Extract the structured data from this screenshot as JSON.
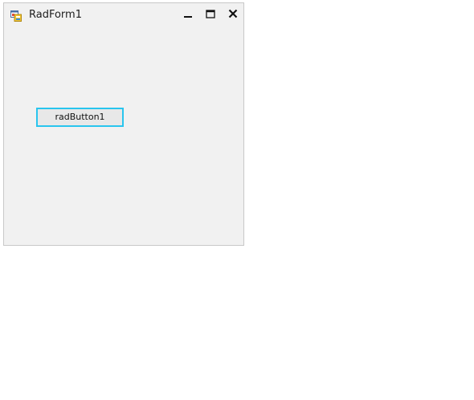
{
  "window": {
    "title": "RadForm1",
    "icon": "app-form-icon",
    "controls": {
      "minimize": "minimize-icon",
      "maximize": "maximize-icon",
      "close": "close-icon"
    }
  },
  "content": {
    "button_label": "radButton1"
  },
  "colors": {
    "form_background": "#f1f1f1",
    "button_focus_border": "#29c5ee",
    "button_background": "#e8e8e8"
  }
}
